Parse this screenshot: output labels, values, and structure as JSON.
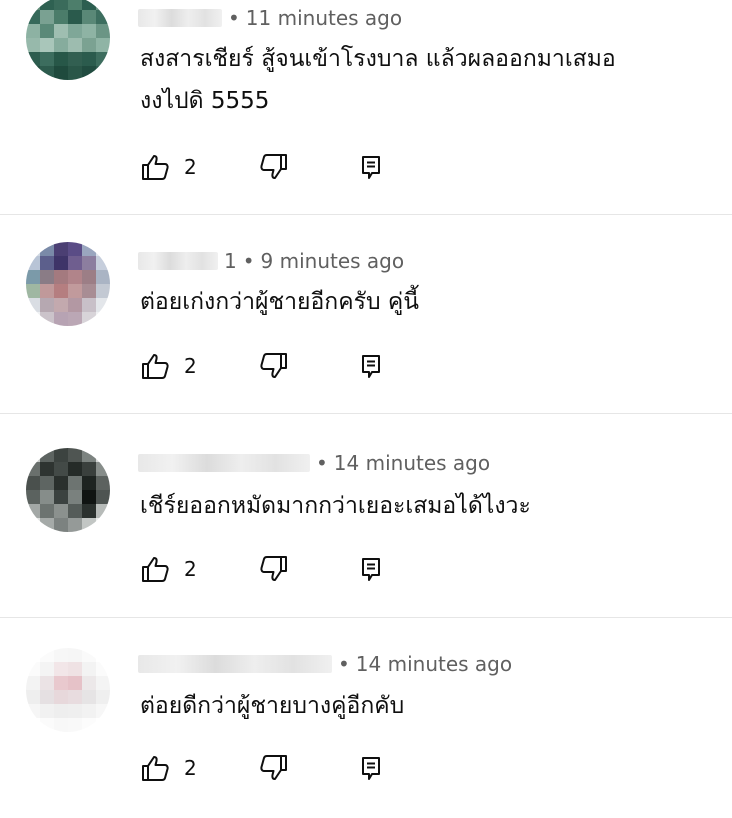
{
  "comments": [
    {
      "author_suffix": "",
      "time": "11 minutes ago",
      "text_lines": [
        "สงสารเชียร์ สู้จนเข้าโรงบาล แล้วผลออกมาเสมอ",
        "งงไปดิ 5555"
      ],
      "likes": "2"
    },
    {
      "author_suffix": "1",
      "time": "9 minutes ago",
      "text_lines": [
        "ต่อยเก่งกว่าผู้ชายอีกครับ คู่นี้"
      ],
      "likes": "2"
    },
    {
      "author_suffix": "",
      "time": "14 minutes ago",
      "text_lines": [
        "เชีร์ยออกหมัดมากกว่าเยอะเสมอได้ไงวะ"
      ],
      "likes": "2"
    },
    {
      "author_suffix": "",
      "time": "14 minutes ago",
      "text_lines": [
        "ต่อยดีกว่าผู้ชายบางคู่อีกคับ"
      ],
      "likes": "2"
    }
  ],
  "meta_separator": "•",
  "icons": {
    "like": "thumbs-up-icon",
    "dislike": "thumbs-down-icon",
    "reply": "reply-icon"
  },
  "colors": {
    "text": "#0f0f0f",
    "meta": "#606060",
    "divider": "#e6e6e6"
  }
}
